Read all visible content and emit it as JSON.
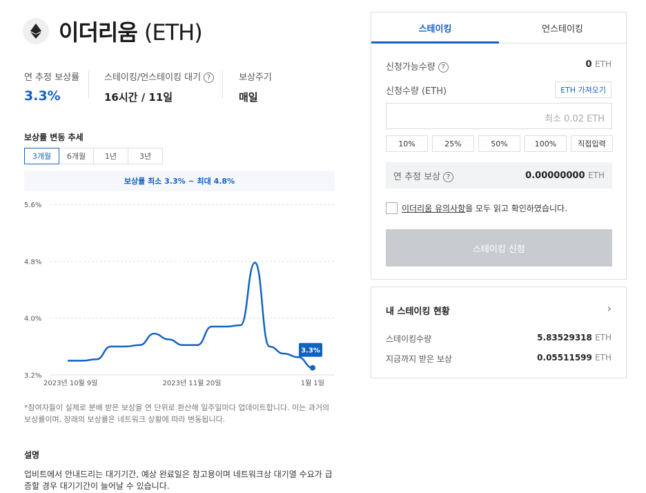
{
  "header": {
    "coin_name": "이더리움",
    "coin_symbol": "(ETH)"
  },
  "stats": [
    {
      "label": "연 추정 보상률",
      "value": "3.3%"
    },
    {
      "label": "스테이킹/언스테이킹 대기",
      "value": "16시간 / 11일"
    },
    {
      "label": "보상주기",
      "value": "매일"
    }
  ],
  "trend": {
    "title": "보상률 변동 추세",
    "periods": [
      "3개월",
      "6개월",
      "1년",
      "3년"
    ],
    "range_text": "보상률 최소 3.3% ~ 최대 4.8%",
    "note": "*참여자들이 실제로 분배 받은 보상을 연 단위로 환산해 일주일마다 업데이트합니다. 이는 과거의 보상률이며, 장래의 보상률은 네트워크 상황에 따라 변동됩니다."
  },
  "chart_data": {
    "type": "line",
    "ytick_labels": [
      "5.6%",
      "4.8%",
      "4.0%",
      "3.2%"
    ],
    "yticks": [
      5.6,
      4.8,
      4.0,
      3.2
    ],
    "ylim": [
      3.2,
      5.6
    ],
    "xtick_labels": [
      "2023년 10월 9일",
      "2023년 11월 20일",
      "1월 1일"
    ],
    "series": [
      {
        "values": [
          3.4,
          3.4,
          3.42,
          3.6,
          3.6,
          3.62,
          3.78,
          3.7,
          3.62,
          3.62,
          3.88,
          3.88,
          3.9,
          4.78,
          3.6,
          3.5,
          3.45,
          3.3
        ]
      }
    ],
    "last_label": "3.3%",
    "color": "#1261c4"
  },
  "description": {
    "title": "설명",
    "text": "업비트에서 안내드리는 대기기간, 예상 완료일은 참고용이며 네트워크상 대기열 수요가 급증할 경우 대기기간이 늘어날 수 있습니다."
  },
  "staking_panel": {
    "tabs": [
      "스테이킹",
      "언스테이킹"
    ],
    "available_label": "신청가능수량",
    "available_value": "0",
    "unit": "ETH",
    "amount_label": "신청수량 (ETH)",
    "fetch_label": "ETH 가져오기",
    "amount_placeholder": "최소 0.02 ETH",
    "percent_buttons": [
      "10%",
      "25%",
      "50%",
      "100%",
      "직접입력"
    ],
    "estimated_label": "연 추정 보상",
    "estimated_value": "0.00000000",
    "agree_link": "이더리움 유의사항",
    "agree_text": "을 모두 읽고 확인하였습니다.",
    "submit_label": "스테이킹 신청"
  },
  "status_panel": {
    "title": "내 스테이킹 현황",
    "rows": [
      {
        "label": "스테이킹수량",
        "value": "5.83529318"
      },
      {
        "label": "지금까지 받은 보상",
        "value": "0.05511599"
      }
    ]
  }
}
